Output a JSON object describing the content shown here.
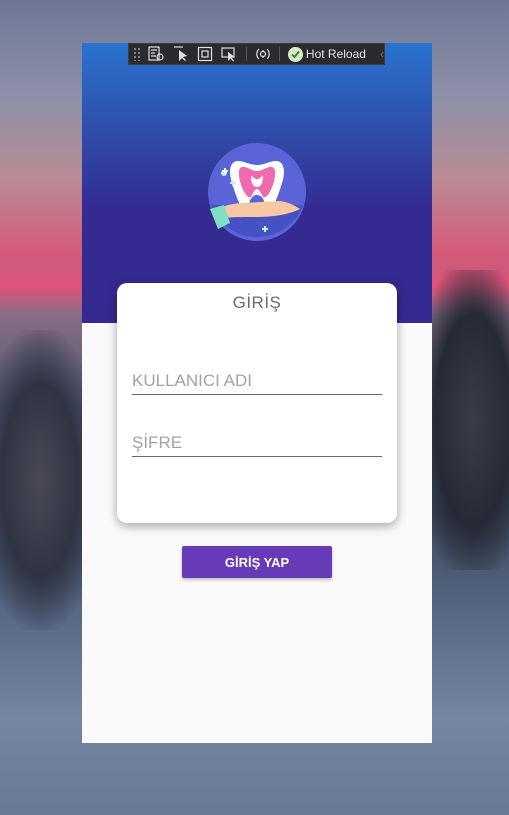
{
  "toolbar": {
    "hot_reload_label": "Hot Reload",
    "icons": [
      "live-visual-tree-icon",
      "select-element-icon",
      "display-layout-adorners-icon",
      "track-focus-icon",
      "binding-failures-icon",
      "hot-reload-status-icon",
      "collapse-chevron-icon"
    ]
  },
  "login": {
    "title": "GİRİŞ",
    "username_placeholder": "KULLANICI ADI",
    "password_placeholder": "ŞİFRE",
    "submit_label": "GİRİŞ YAP"
  },
  "colors": {
    "header_top": "#2a73cf",
    "header_bottom": "#352a8f",
    "button": "#673ab7",
    "card": "#ffffff",
    "page": "#fafafa"
  }
}
